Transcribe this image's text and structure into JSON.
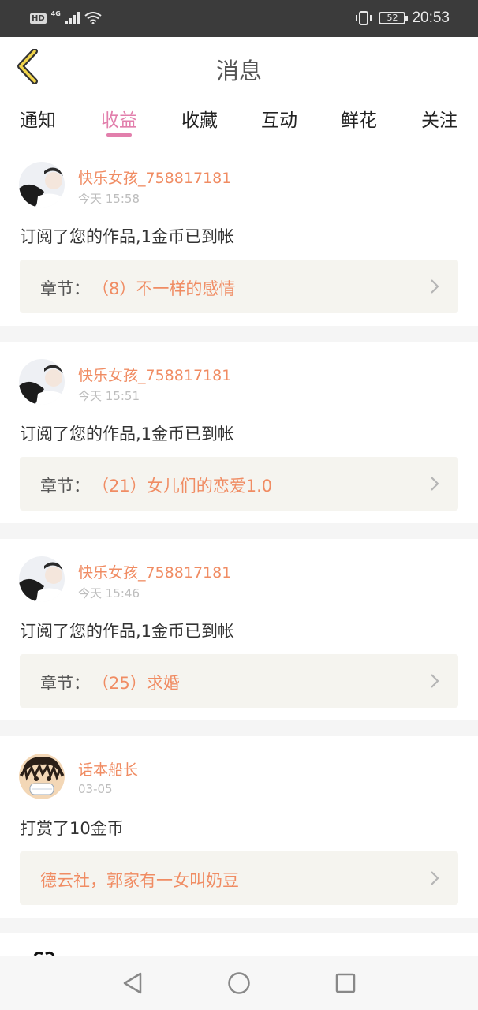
{
  "status_bar": {
    "hd": "HD",
    "network": "4G",
    "battery": "52",
    "time": "20:53"
  },
  "header": {
    "title": "消息"
  },
  "tabs": [
    {
      "label": "通知",
      "active": false
    },
    {
      "label": "收益",
      "active": true
    },
    {
      "label": "收藏",
      "active": false
    },
    {
      "label": "互动",
      "active": false
    },
    {
      "label": "鲜花",
      "active": false
    },
    {
      "label": "关注",
      "active": false
    }
  ],
  "messages": [
    {
      "username": "快乐女孩_758817181",
      "time": "今天 15:58",
      "action": "订阅了您的作品,1金币已到帐",
      "link_prefix": "章节：",
      "link_title": "（8）不一样的感情"
    },
    {
      "username": "快乐女孩_758817181",
      "time": "今天 15:51",
      "action": "订阅了您的作品,1金币已到帐",
      "link_prefix": "章节：",
      "link_title": "（21）女儿们的恋爱1.0"
    },
    {
      "username": "快乐女孩_758817181",
      "time": "今天 15:46",
      "action": "订阅了您的作品,1金币已到帐",
      "link_prefix": "章节：",
      "link_title": "（25）求婚"
    },
    {
      "username": "话本船长",
      "time": "03-05",
      "action": "打赏了10金币",
      "link_prefix": "",
      "link_title": "德云社，郭家有一女叫奶豆"
    }
  ],
  "colors": {
    "accent": "#e27fac",
    "username": "#f08c63",
    "status_bar": "#3b3b3b",
    "link_box": "#f5f4ef"
  },
  "icons": {
    "back": "chevron-left-icon",
    "nav_back": "triangle-back-icon",
    "nav_home": "circle-home-icon",
    "nav_recent": "square-recents-icon"
  }
}
